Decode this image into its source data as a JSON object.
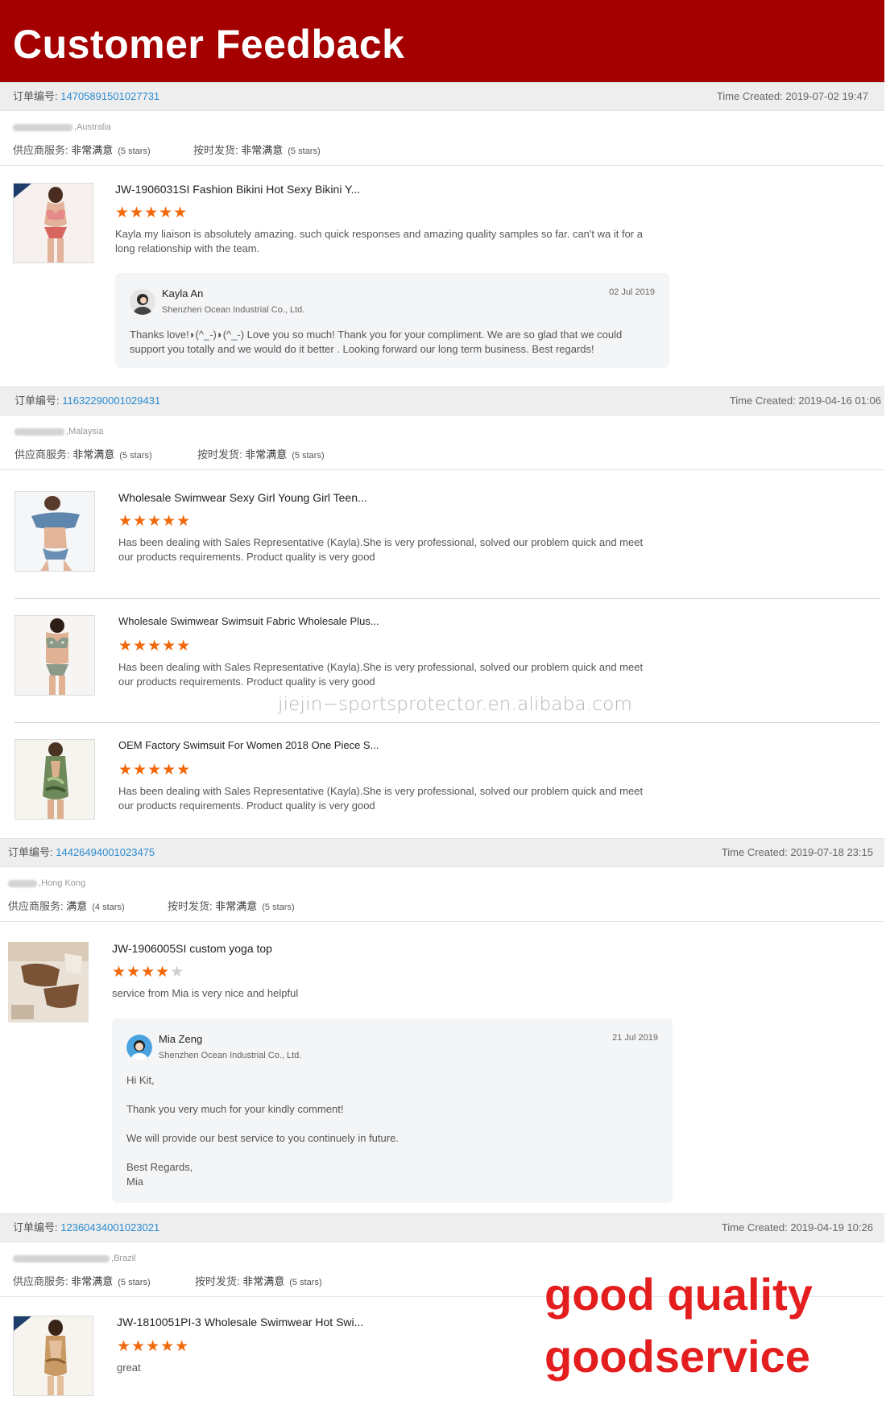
{
  "banner": {
    "title": "Customer Feedback"
  },
  "labels": {
    "order_no": "订单编号:",
    "time_created": "Time Created:",
    "supplier_service": "供应商服务:",
    "on_time": "按时发货:"
  },
  "orders": [
    {
      "order_no": "14705891501027731",
      "time_created": "2019-07-02 19:47",
      "country": "Australia",
      "supplier_rating": "非常满意",
      "supplier_stars": "(5 stars)",
      "delivery_rating": "非常满意",
      "delivery_stars": "(5 stars)",
      "items": [
        {
          "title": "JW-1906031SI Fashion Bikini Hot Sexy Bikini Y...",
          "stars": 5,
          "comment": "Kayla my liaison is absolutely amazing. such quick responses and amazing quality samples so far. can't wa it for a long relationship with the team."
        }
      ],
      "reply": {
        "name": "Kayla An",
        "company": "Shenzhen Ocean Industrial Co., Ltd.",
        "date": "02 Jul 2019",
        "text": "Thanks love!◗(^_-)◗(^_-) Love you so much! Thank you for your compliment. We are so glad that we could support you totally and we would do it better . Looking forward our long term business. Best regards!"
      }
    },
    {
      "order_no": "11632290001029431",
      "time_created": "2019-04-16 01:06",
      "country": "Malaysia",
      "supplier_rating": "非常满意",
      "supplier_stars": "(5 stars)",
      "delivery_rating": "非常满意",
      "delivery_stars": "(5 stars)",
      "items": [
        {
          "title": "Wholesale Swimwear Sexy Girl Young Girl Teen...",
          "stars": 5,
          "comment": "Has been dealing with Sales Representative (Kayla).She is very professional, solved our problem quick and meet our products requirements. Product quality is very good"
        },
        {
          "title": "Wholesale Swimwear Swimsuit Fabric Wholesale Plus...",
          "stars": 5,
          "comment": "Has been dealing with Sales Representative (Kayla).She is very professional, solved our problem quick and meet our products requirements. Product quality is very good"
        },
        {
          "title": "OEM Factory Swimsuit For Women 2018 One Piece S...",
          "stars": 5,
          "comment": "Has been dealing with Sales Representative (Kayla).She is very professional, solved our problem quick and meet our products requirements. Product quality is very good"
        }
      ]
    },
    {
      "order_no": "14426494001023475",
      "time_created": "2019-07-18 23:15",
      "country": "Hong Kong",
      "supplier_rating": "满意",
      "supplier_stars": "(4 stars)",
      "delivery_rating": "非常满意",
      "delivery_stars": "(5 stars)",
      "items": [
        {
          "title": "JW-1906005SI custom yoga top",
          "stars": 4,
          "comment": "service from Mia is very nice and helpful"
        }
      ],
      "reply": {
        "name": "Mia Zeng",
        "company": "Shenzhen Ocean Industrial Co., Ltd.",
        "date": "21 Jul 2019",
        "lines": [
          "Hi Kit,",
          "Thank you very much for your kindly comment!",
          "We will provide our best service to you continuely in future.",
          "Best Regards,",
          "Mia"
        ]
      }
    },
    {
      "order_no": "12360434001023021",
      "time_created": "2019-04-19 10:26",
      "country": "Brazil",
      "supplier_rating": "非常满意",
      "supplier_stars": "(5 stars)",
      "delivery_rating": "非常满意",
      "delivery_stars": "(5 stars)",
      "items": [
        {
          "title": "JW-1810051PI-3 Wholesale Swimwear Hot Swi...",
          "stars": 5,
          "comment": "great"
        }
      ]
    }
  ],
  "watermark": "jiejin−sportsprotector.en.alibaba.com",
  "slogan": {
    "line1": "good quality",
    "line2": "goodservice"
  },
  "colors": {
    "banner": "#a50000",
    "star": "#f2690c",
    "link": "#2a8bd0",
    "slogan": "#e41e1e"
  }
}
